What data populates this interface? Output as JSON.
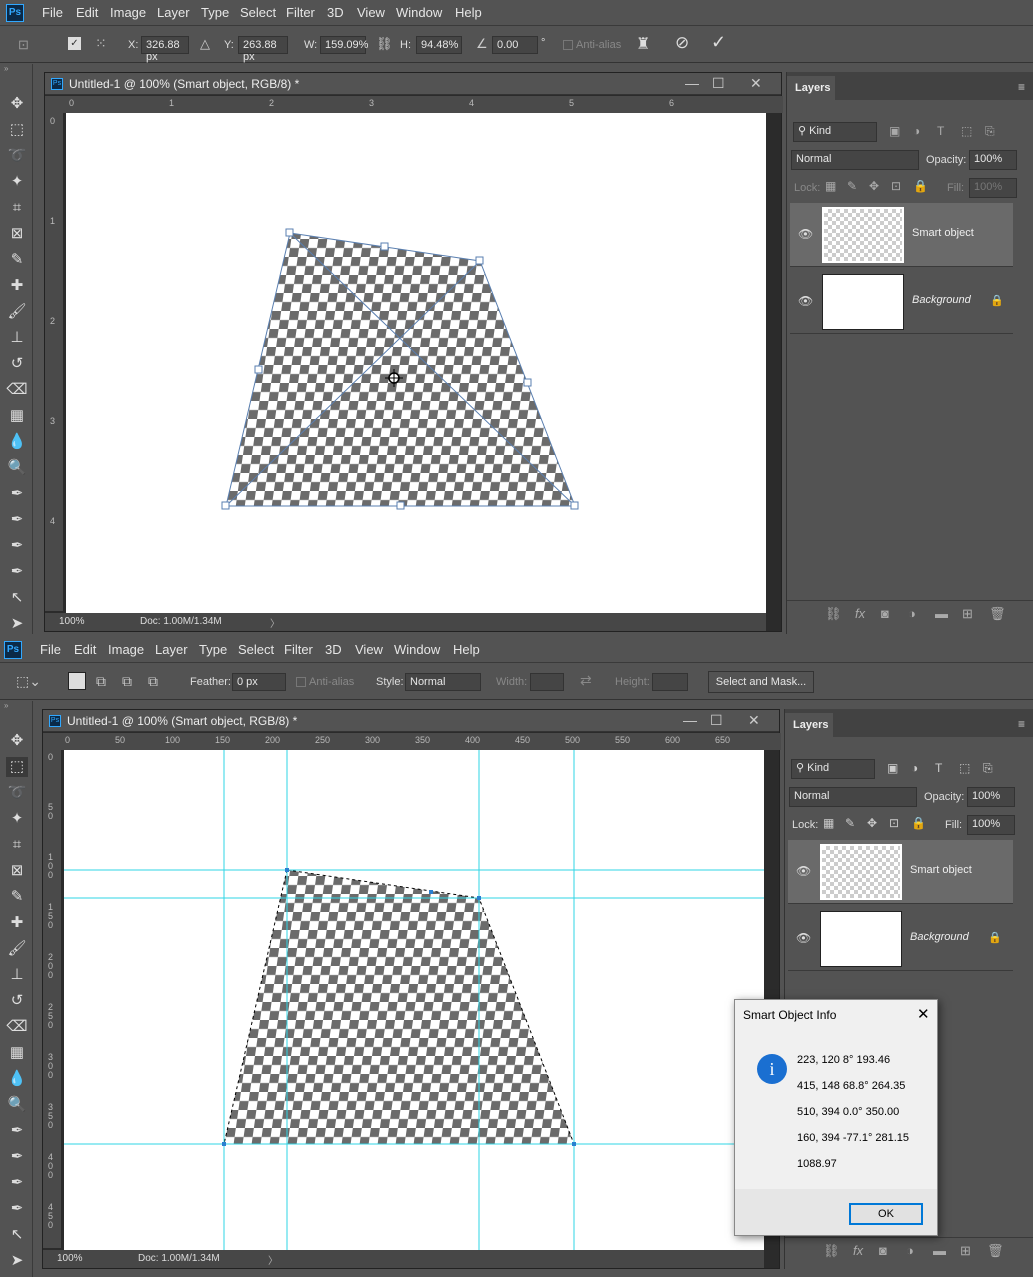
{
  "top": {
    "app_logo": "Ps",
    "menu": [
      "File",
      "Edit",
      "Image",
      "Layer",
      "Type",
      "Select",
      "Filter",
      "3D",
      "View",
      "Window",
      "Help"
    ],
    "options": {
      "x_label": "X:",
      "x_value": "326.88 px",
      "y_label": "Y:",
      "y_value": "263.88 px",
      "w_label": "W:",
      "w_value": "159.09%",
      "h_label": "H:",
      "h_value": "94.48%",
      "angle_value": "0.00",
      "degree": "°",
      "anti_alias": "Anti-alias"
    },
    "doc_title": "Untitled-1 @ 100% (Smart object, RGB/8) *",
    "ruler_h": [
      "0",
      "1",
      "2",
      "3",
      "4",
      "5",
      "6"
    ],
    "ruler_v": [
      "0",
      "1",
      "2",
      "3",
      "4"
    ],
    "zoom": "100%",
    "doc_size": "Doc: 1.00M/1.34M"
  },
  "bottom": {
    "app_logo": "Ps",
    "menu": [
      "File",
      "Edit",
      "Image",
      "Layer",
      "Type",
      "Select",
      "Filter",
      "3D",
      "View",
      "Window",
      "Help"
    ],
    "options": {
      "feather_label": "Feather:",
      "feather_value": "0 px",
      "anti_alias": "Anti-alias",
      "style_label": "Style:",
      "style_value": "Normal",
      "width_label": "Width:",
      "height_label": "Height:",
      "select_mask": "Select and Mask..."
    },
    "doc_title": "Untitled-1 @ 100% (Smart object, RGB/8) *",
    "ruler_h": [
      "0",
      "50",
      "100",
      "150",
      "200",
      "250",
      "300",
      "350",
      "400",
      "450",
      "500",
      "550",
      "600",
      "650"
    ],
    "ruler_v": [
      "0",
      "5\n0",
      "1\n0\n0",
      "1\n5\n0",
      "2\n0\n0",
      "2\n5\n0",
      "3\n0\n0",
      "3\n5\n0",
      "4\n0\n0",
      "4\n5\n0"
    ],
    "zoom": "100%",
    "doc_size": "Doc: 1.00M/1.34M"
  },
  "layers_panel": {
    "tab": "Layers",
    "kind": "Kind",
    "blend_mode": "Normal",
    "opacity_label": "Opacity:",
    "opacity_value": "100%",
    "lock_label": "Lock:",
    "fill_label": "Fill:",
    "fill_value": "100%",
    "layers": [
      {
        "name": "Smart object"
      },
      {
        "name": "Background"
      }
    ]
  },
  "dialog": {
    "title": "Smart Object Info",
    "lines": [
      "223, 120 8° 193.46",
      "415, 148 68.8° 264.35",
      "510, 394 0.0° 350.00",
      "160, 394 -77.1° 281.15",
      "1088.97"
    ],
    "ok": "OK"
  },
  "colors": {
    "guide": "#2fd6e6",
    "accent": "#31a8ff",
    "bbox": "#5a7fb0"
  }
}
